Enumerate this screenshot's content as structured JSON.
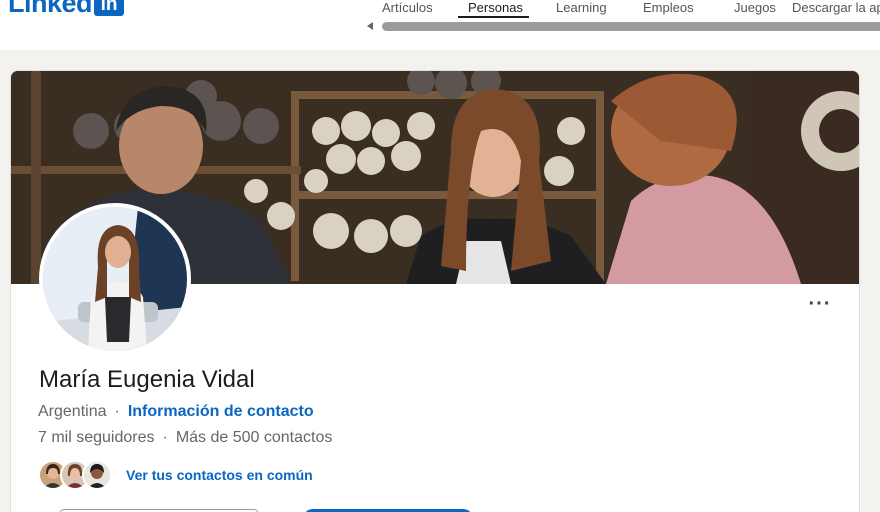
{
  "header": {
    "logo_text": "Linked",
    "logo_box": "in",
    "nav": [
      {
        "label": "Artículos"
      },
      {
        "label": "Personas"
      },
      {
        "label": "Learning"
      },
      {
        "label": "Empleos"
      },
      {
        "label": "Juegos"
      },
      {
        "label": "Descargar la ap"
      }
    ],
    "active_nav": "Personas"
  },
  "profile": {
    "name": "María Eugenia Vidal",
    "location": "Argentina",
    "contact_info_label": "Información de contacto",
    "followers": "7 mil seguidores",
    "connections": "Más de 500 contactos",
    "mutual_label": "Ver tus contactos en común",
    "more_label": "···"
  },
  "colors": {
    "brand": "#0a66c2",
    "text": "#1d1d1d",
    "muted": "#666666",
    "background": "#f4f2ee"
  },
  "icons": [
    "more-options-icon",
    "scroll-left-arrow-icon"
  ]
}
